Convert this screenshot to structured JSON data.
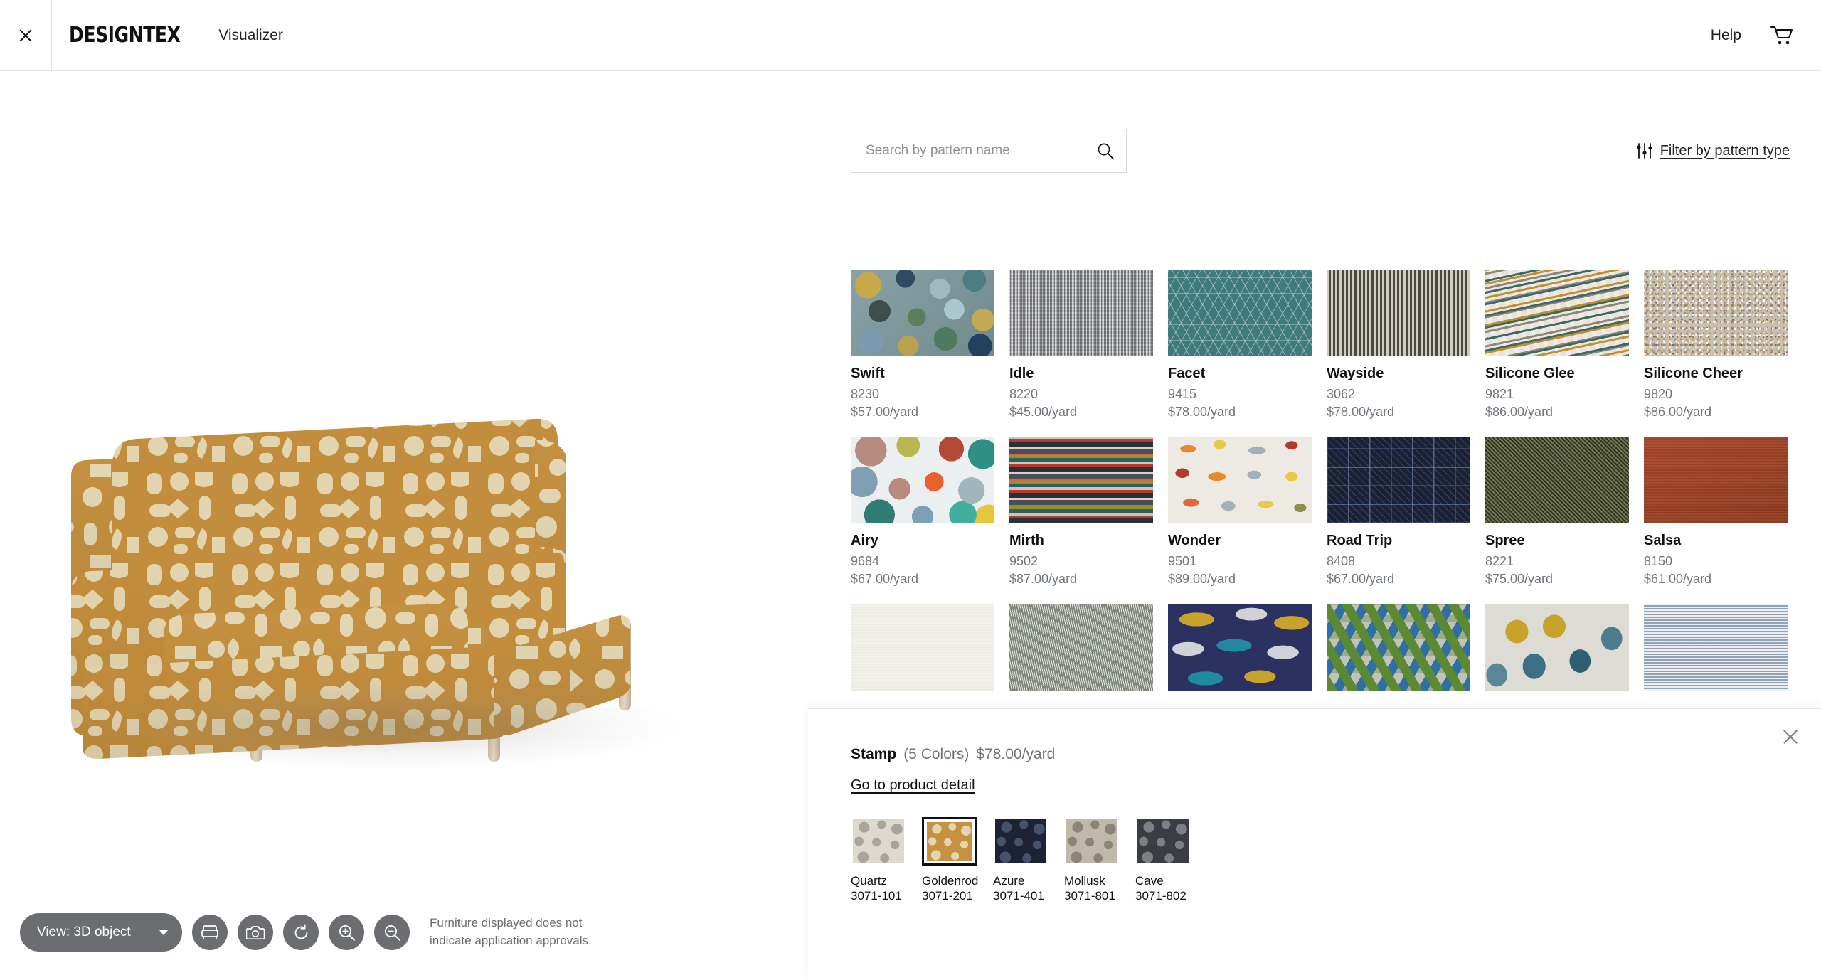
{
  "header": {
    "close_label": "close-window",
    "brand": "DESIGNTEX",
    "app_name": "Visualizer",
    "help_label": "Help",
    "cart_label": "cart"
  },
  "viewer": {
    "toolbar": {
      "view_label": "View: 3D object",
      "buttons": [
        {
          "name": "furniture-icon",
          "label": "furniture"
        },
        {
          "name": "camera-icon",
          "label": "camera"
        },
        {
          "name": "reset-rotation-icon",
          "label": "reset"
        },
        {
          "name": "zoom-in-icon",
          "label": "zoom in"
        },
        {
          "name": "zoom-out-icon",
          "label": "zoom out"
        }
      ]
    },
    "disclaimer_line1": "Furniture displayed does not",
    "disclaimer_line2": "indicate application approvals.",
    "applied_color": "#c6923f"
  },
  "search": {
    "placeholder": "Search by pattern name",
    "value": "",
    "filter_label": "Filter by pattern type"
  },
  "products": [
    {
      "name": "Swift",
      "sku": "8230",
      "price": "$57.00/yard",
      "swatch": "swift"
    },
    {
      "name": "Idle",
      "sku": "8220",
      "price": "$45.00/yard",
      "swatch": "idle"
    },
    {
      "name": "Facet",
      "sku": "9415",
      "price": "$78.00/yard",
      "swatch": "facet"
    },
    {
      "name": "Wayside",
      "sku": "3062",
      "price": "$78.00/yard",
      "swatch": "wayside"
    },
    {
      "name": "Silicone Glee",
      "sku": "9821",
      "price": "$86.00/yard",
      "swatch": "glee"
    },
    {
      "name": "Silicone Cheer",
      "sku": "9820",
      "price": "$86.00/yard",
      "swatch": "cheer"
    },
    {
      "name": "Airy",
      "sku": "9684",
      "price": "$67.00/yard",
      "swatch": "airy"
    },
    {
      "name": "Mirth",
      "sku": "9502",
      "price": "$87.00/yard",
      "swatch": "mirth"
    },
    {
      "name": "Wonder",
      "sku": "9501",
      "price": "$89.00/yard",
      "swatch": "wonder"
    },
    {
      "name": "Road Trip",
      "sku": "8408",
      "price": "$67.00/yard",
      "swatch": "roadtrip"
    },
    {
      "name": "Spree",
      "sku": "8221",
      "price": "$75.00/yard",
      "swatch": "spree"
    },
    {
      "name": "Salsa",
      "sku": "8150",
      "price": "$61.00/yard",
      "swatch": "salsa"
    }
  ],
  "partial_row": [
    {
      "swatch": "ivory"
    },
    {
      "swatch": "tweedgrey"
    },
    {
      "swatch": "navyoval"
    },
    {
      "swatch": "greentri"
    },
    {
      "swatch": "leafblue"
    },
    {
      "swatch": "bluestripe"
    }
  ],
  "detail": {
    "name": "Stamp",
    "colors_count": "(5 Colors)",
    "price": "$78.00/yard",
    "product_link": "Go to product detail",
    "selected_index": 1,
    "colors": [
      {
        "name": "Quartz",
        "sku": "3071-101",
        "base": "#ded9cd",
        "shape": "#a9a59d"
      },
      {
        "name": "Goldenrod",
        "sku": "3071-201",
        "base": "#c6923f",
        "shape": "#e3d5b0"
      },
      {
        "name": "Azure",
        "sku": "3071-401",
        "base": "#1d2335",
        "shape": "#46516b"
      },
      {
        "name": "Mollusk",
        "sku": "3071-801",
        "base": "#c0b8a8",
        "shape": "#8b8578"
      },
      {
        "name": "Cave",
        "sku": "3071-802",
        "base": "#3a3d42",
        "shape": "#7b7f86"
      }
    ]
  }
}
